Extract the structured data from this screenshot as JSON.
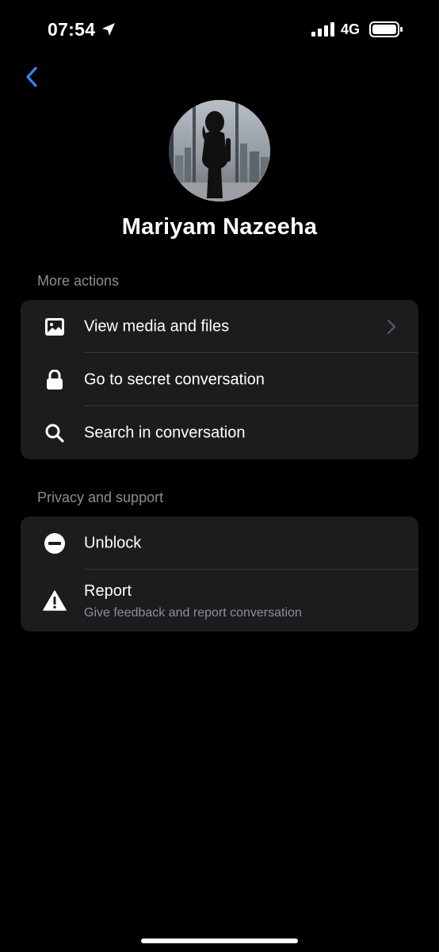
{
  "status_bar": {
    "time": "07:54",
    "network": "4G"
  },
  "profile": {
    "name": "Mariyam Nazeeha"
  },
  "sections": {
    "more_actions": {
      "title": "More actions",
      "items": [
        {
          "label": "View media and files",
          "icon": "image-icon"
        },
        {
          "label": "Go to secret conversation",
          "icon": "lock-icon"
        },
        {
          "label": "Search in conversation",
          "icon": "search-icon"
        }
      ]
    },
    "privacy_support": {
      "title": "Privacy and support",
      "items": [
        {
          "label": "Unblock",
          "icon": "minus-circle-icon"
        },
        {
          "label": "Report",
          "sublabel": "Give feedback and report conversation",
          "icon": "warning-triangle-icon"
        }
      ]
    }
  },
  "colors": {
    "background": "#000000",
    "card": "#1c1c1e",
    "accent": "#3b82f6",
    "secondary_text": "#8d8d93"
  }
}
